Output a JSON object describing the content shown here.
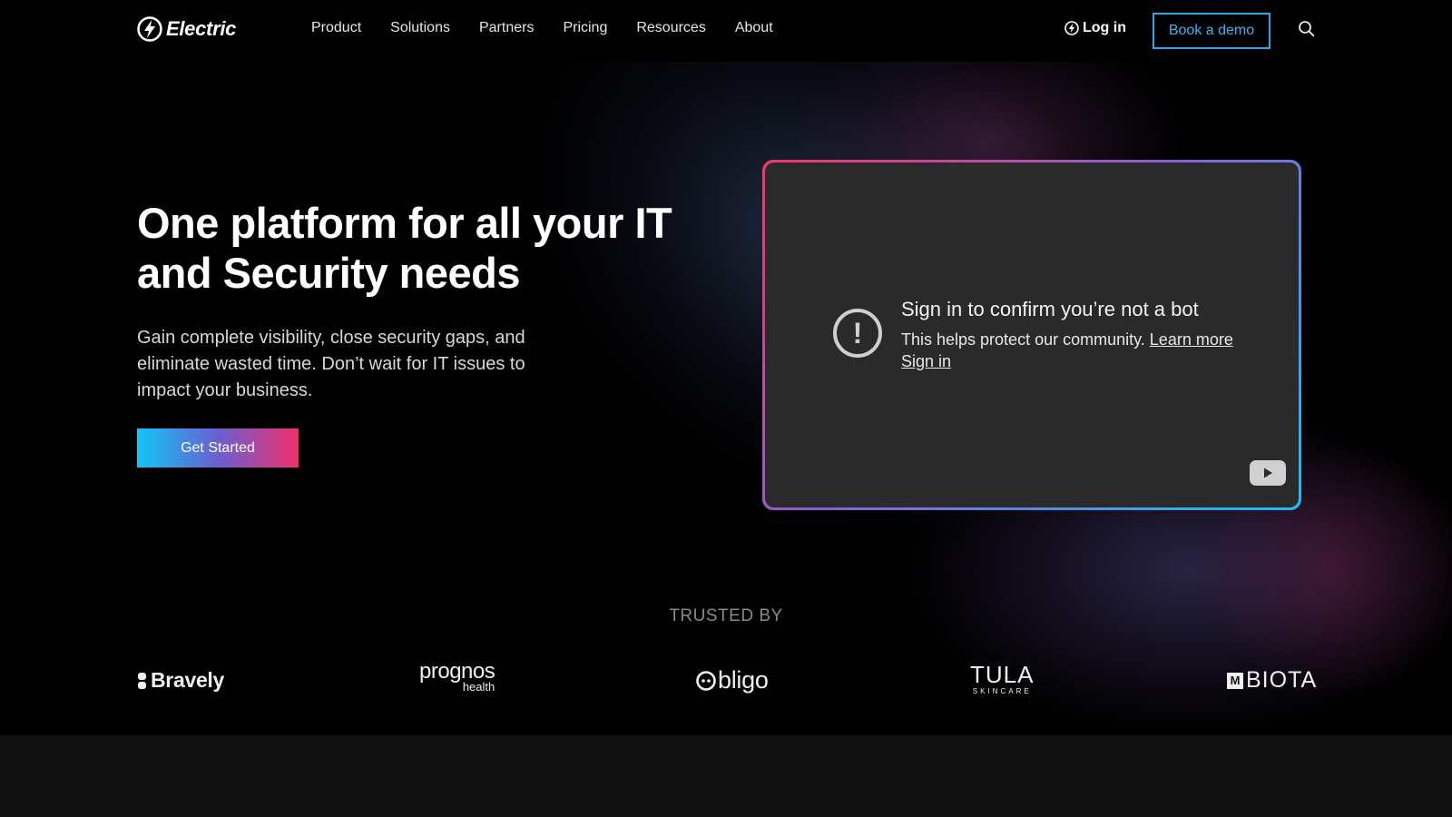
{
  "nav": {
    "logo": "Electric",
    "links": [
      "Product",
      "Solutions",
      "Partners",
      "Pricing",
      "Resources",
      "About"
    ],
    "login": "Log in",
    "demo": "Book a demo"
  },
  "hero": {
    "headline_line1": "One platform for all your IT",
    "headline_line2": "and Security needs",
    "subtext_line1": "Gain complete visibility, close security gaps, and",
    "subtext_line2": "eliminate wasted time. Don’t wait for IT issues to",
    "subtext_line3": "impact your business.",
    "cta": "Get Started"
  },
  "video": {
    "title": "Sign in to confirm you’re not a bot",
    "description": "This helps protect our community.",
    "learn_more": "Learn more",
    "sign_in": "Sign in"
  },
  "trusted": {
    "label": "TRUSTED BY",
    "brands": {
      "bravely": "Bravely",
      "prognos": "prognos",
      "prognos_sub": "health",
      "obligo": "bligo",
      "tula": "TULA",
      "tula_sub": "SKINCARE",
      "biota": "BIOTA",
      "biota_mark": "M"
    }
  },
  "colors": {
    "accent_blue": "#2fa6e6",
    "gradient_start": "#10c6f5",
    "gradient_end": "#f0306a"
  }
}
